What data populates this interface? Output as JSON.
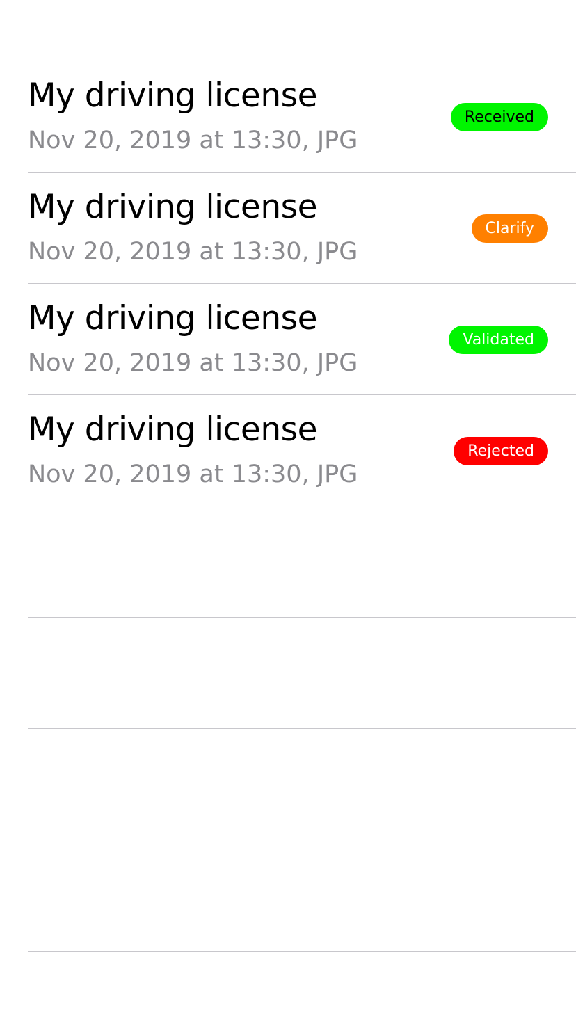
{
  "documents": [
    {
      "title": "My driving license",
      "subtitle": "Nov 20, 2019 at 13:30, JPG",
      "status": "Received",
      "status_color": "#00f500",
      "status_text_color": "#000000"
    },
    {
      "title": "My driving license",
      "subtitle": "Nov 20, 2019 at 13:30, JPG",
      "status": "Clarify",
      "status_color": "#ff8000",
      "status_text_color": "#ffffff"
    },
    {
      "title": "My driving license",
      "subtitle": "Nov 20, 2019 at 13:30, JPG",
      "status": "Validated",
      "status_color": "#00f500",
      "status_text_color": "#ffffff"
    },
    {
      "title": "My driving license",
      "subtitle": "Nov 20, 2019 at 13:30, JPG",
      "status": "Rejected",
      "status_color": "#ff0000",
      "status_text_color": "#ffffff"
    }
  ]
}
